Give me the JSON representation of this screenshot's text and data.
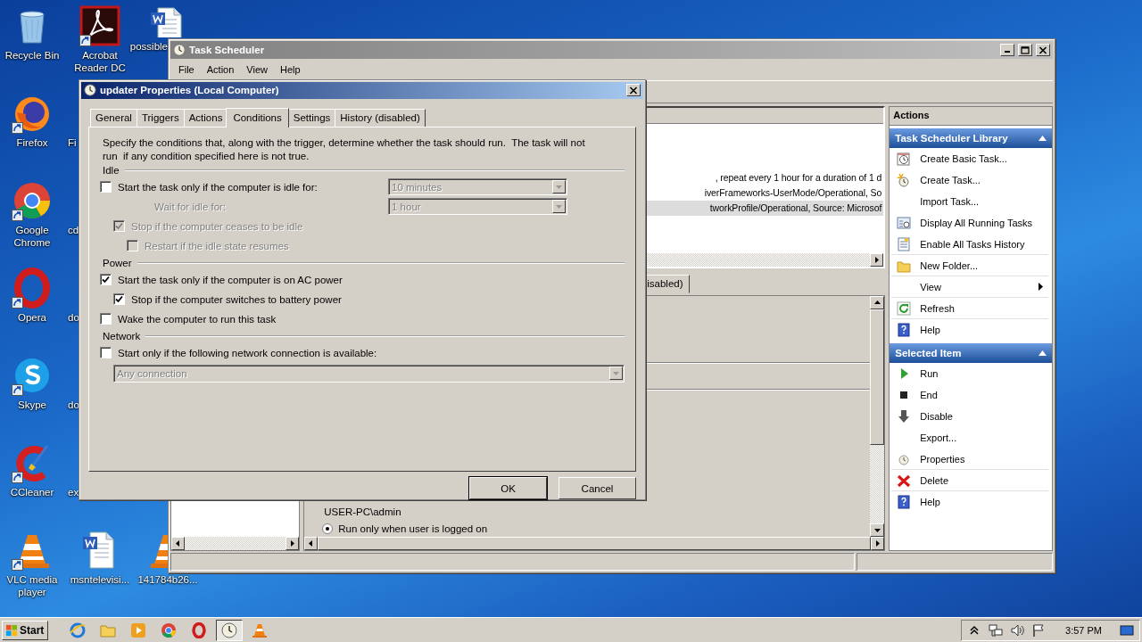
{
  "desktop": {
    "icons": [
      {
        "label": "Recycle Bin",
        "kind": "recycle",
        "shortcut": false
      },
      {
        "label": "Acrobat Reader DC",
        "kind": "pdf",
        "shortcut": true
      },
      {
        "label": "possible",
        "kind": "doc-top",
        "shortcut": false
      },
      {
        "label": "Firefox",
        "kind": "firefox",
        "shortcut": true
      },
      {
        "label": "Fi",
        "kind": "covered"
      },
      {
        "label": "Google Chrome",
        "kind": "chrome",
        "shortcut": true
      },
      {
        "label": "cd",
        "kind": "covered"
      },
      {
        "label": "Opera",
        "kind": "opera",
        "shortcut": true
      },
      {
        "label": "do",
        "kind": "covered"
      },
      {
        "label": "Skype",
        "kind": "skype",
        "shortcut": true
      },
      {
        "label": "do",
        "kind": "covered"
      },
      {
        "label": "CCleaner",
        "kind": "ccleaner",
        "shortcut": true
      },
      {
        "label": "ex",
        "kind": "covered"
      },
      {
        "label": "VLC media player",
        "kind": "vlc",
        "shortcut": true
      },
      {
        "label": "msntelevisi...",
        "kind": "doc",
        "shortcut": false
      },
      {
        "label": "141784b26...",
        "kind": "vlc-left",
        "shortcut": false
      }
    ]
  },
  "scheduler": {
    "title": "Task Scheduler",
    "menu": [
      "File",
      "Action",
      "View",
      "Help"
    ],
    "task_lines": [
      {
        "text": ", repeat every 1 hour for a duration of 1 d",
        "selected": false
      },
      {
        "text": "iverFrameworks-UserMode/Operational, So",
        "selected": false
      },
      {
        "text": "tworkProfile/Operational, Source: Microsof",
        "selected": true
      }
    ],
    "detail_tab": "isabled)",
    "author": "USER-PC\\admin",
    "run_option": {
      "label": "Run only when user is logged on",
      "selected": true
    },
    "actions": {
      "title": "Actions",
      "sections": [
        {
          "title": "Task Scheduler Library",
          "items": [
            {
              "label": "Create Basic Task...",
              "kind": "calendar",
              "has_submenu": false,
              "divider_below": false
            },
            {
              "label": "Create Task...",
              "kind": "create",
              "has_submenu": false,
              "divider_below": false
            },
            {
              "label": "Import Task...",
              "has_submenu": false,
              "divider_below": false
            },
            {
              "label": "Display All Running Tasks",
              "kind": "running",
              "has_submenu": false,
              "divider_below": false
            },
            {
              "label": "Enable All Tasks History",
              "kind": "history",
              "has_submenu": false,
              "divider_below": true
            },
            {
              "label": "New Folder...",
              "kind": "folder",
              "has_submenu": false,
              "divider_below": true
            },
            {
              "label": "View",
              "has_submenu": true,
              "divider_below": true
            },
            {
              "label": "Refresh",
              "kind": "refresh",
              "has_submenu": false,
              "divider_below": true
            },
            {
              "label": "Help",
              "kind": "help",
              "has_submenu": false,
              "divider_below": false
            }
          ]
        },
        {
          "title": "Selected Item",
          "items": [
            {
              "label": "Run",
              "kind": "run",
              "has_submenu": false,
              "divider_below": false
            },
            {
              "label": "End",
              "kind": "end",
              "has_submenu": false,
              "divider_below": false
            },
            {
              "label": "Disable",
              "kind": "disable",
              "has_submenu": false,
              "divider_below": false
            },
            {
              "label": "Export...",
              "has_submenu": false,
              "divider_below": false
            },
            {
              "label": "Properties",
              "kind": "properties",
              "has_submenu": false,
              "divider_below": true
            },
            {
              "label": "Delete",
              "kind": "delete",
              "has_submenu": false,
              "divider_below": true
            },
            {
              "label": "Help",
              "kind": "help",
              "has_submenu": false,
              "divider_below": false
            }
          ]
        }
      ]
    }
  },
  "dialog": {
    "title": "updater Properties (Local Computer)",
    "tabs": [
      {
        "label": "General",
        "selected": false
      },
      {
        "label": "Triggers",
        "selected": false
      },
      {
        "label": "Actions",
        "selected": false
      },
      {
        "label": "Conditions",
        "selected": true
      },
      {
        "label": "Settings",
        "selected": false
      },
      {
        "label": "History (disabled)",
        "selected": false
      }
    ],
    "intro": "Specify the conditions that, along with the trigger, determine whether the task should run.  The task will not run  if any condition specified here is not true.",
    "groups": [
      {
        "title": "Idle",
        "rows": [
          {
            "kind": "checkbox",
            "label": "Start the task only if the computer is idle for:",
            "checked": false,
            "disabled": false,
            "combo": {
              "value": "10 minutes",
              "disabled": true
            },
            "children": [
              {
                "kind": "label",
                "label": "Wait for idle for:",
                "disabled": true,
                "combo": {
                  "value": "1 hour",
                  "disabled": true
                }
              },
              {
                "kind": "checkbox",
                "label": "Stop if the computer ceases to be idle",
                "checked": true,
                "disabled": true,
                "children": [
                  {
                    "kind": "checkbox",
                    "label": "Restart if the idle state resumes",
                    "checked": false,
                    "disabled": true
                  }
                ]
              }
            ]
          }
        ]
      },
      {
        "title": "Power",
        "rows": [
          {
            "kind": "checkbox",
            "label": "Start the task only if the computer is on AC power",
            "checked": true,
            "disabled": false,
            "children": [
              {
                "kind": "checkbox",
                "label": "Stop if the computer switches to battery power",
                "checked": true,
                "disabled": false
              }
            ]
          },
          {
            "kind": "checkbox",
            "label": "Wake the computer to run this task",
            "checked": false,
            "disabled": false
          }
        ]
      },
      {
        "title": "Network",
        "rows": [
          {
            "kind": "checkbox",
            "label": "Start only if the following network connection is available:",
            "checked": false,
            "disabled": false,
            "children": [
              {
                "kind": "combo",
                "combo": {
                  "value": "Any connection",
                  "disabled": true
                }
              }
            ]
          }
        ]
      }
    ],
    "buttons": [
      {
        "label": "OK",
        "default": true
      },
      {
        "label": "Cancel",
        "default": false
      }
    ]
  },
  "taskbar": {
    "start": "Start",
    "apps": [
      {
        "kind": "ie",
        "active": false
      },
      {
        "kind": "explorer",
        "active": false
      },
      {
        "kind": "media",
        "active": false
      },
      {
        "kind": "chrome",
        "active": false
      },
      {
        "kind": "opera",
        "active": false
      },
      {
        "kind": "scheduler",
        "active": true
      },
      {
        "kind": "vlc",
        "active": false
      }
    ],
    "time": "3:57 PM"
  }
}
